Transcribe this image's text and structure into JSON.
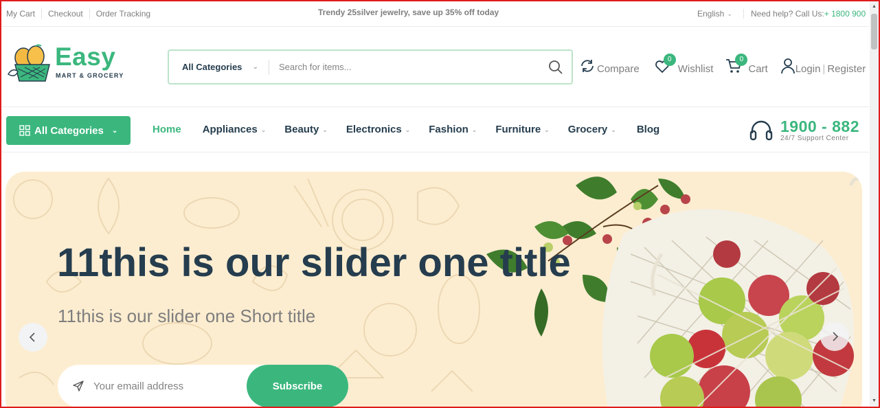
{
  "topbar": {
    "links": [
      "My Cart",
      "Checkout",
      "Order Tracking"
    ],
    "promo": "Trendy 25silver jewelry, save up 35% off today",
    "language": "English",
    "help_text": "Need help? Call Us:",
    "help_phone": "+ 1800 900"
  },
  "header": {
    "logo_word": "Easy",
    "logo_sub": "MART & GROCERY",
    "search": {
      "category": "All Categories",
      "placeholder": "Search for items..."
    },
    "actions": {
      "compare": "Compare",
      "wishlist": "Wishlist",
      "wishlist_count": "0",
      "cart": "Cart",
      "cart_count": "0",
      "login": "Login",
      "register": "Register"
    }
  },
  "nav": {
    "all_categories": "All Categories",
    "items": [
      "Home",
      "Appliances",
      "Beauty",
      "Electronics",
      "Fashion",
      "Furniture",
      "Grocery",
      "Blog"
    ],
    "support_number": "1900 - 882",
    "support_text": "24/7 Support Center"
  },
  "hero": {
    "title": "11this is our slider one title",
    "subtitle": "11this is our slider one Short title",
    "email_placeholder": "Your emaill address",
    "subscribe_label": "Subscribe"
  },
  "colors": {
    "brand_green": "#3bb77e",
    "dark_text": "#253d4e",
    "hero_bg": "#fdedd0"
  }
}
